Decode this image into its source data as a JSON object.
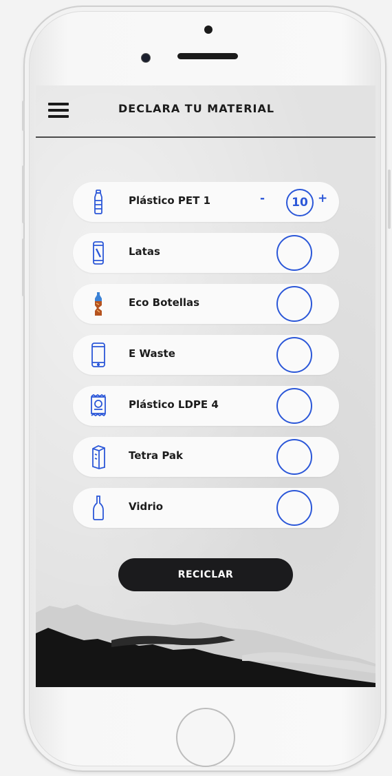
{
  "header": {
    "title": "DECLARA TU MATERIAL"
  },
  "materials": [
    {
      "label": "Plástico PET 1",
      "icon": "pet-bottle-icon",
      "quantity": "10",
      "decrement": "-",
      "increment": "+"
    },
    {
      "label": "Latas",
      "icon": "can-icon",
      "quantity": ""
    },
    {
      "label": "Eco Botellas",
      "icon": "eco-bottle-icon",
      "quantity": ""
    },
    {
      "label": "E Waste",
      "icon": "phone-device-icon",
      "quantity": ""
    },
    {
      "label": "Plástico LDPE 4",
      "icon": "plastic-bag-icon",
      "quantity": ""
    },
    {
      "label": "Tetra Pak",
      "icon": "tetra-pak-icon",
      "quantity": ""
    },
    {
      "label": "Vidrio",
      "icon": "glass-bottle-icon",
      "quantity": ""
    }
  ],
  "actions": {
    "recycle_label": "RECICLAR"
  },
  "colors": {
    "accent": "#2b57d8",
    "button_bg": "#1b1b1d",
    "screen_bg": "#e2e2e2"
  }
}
